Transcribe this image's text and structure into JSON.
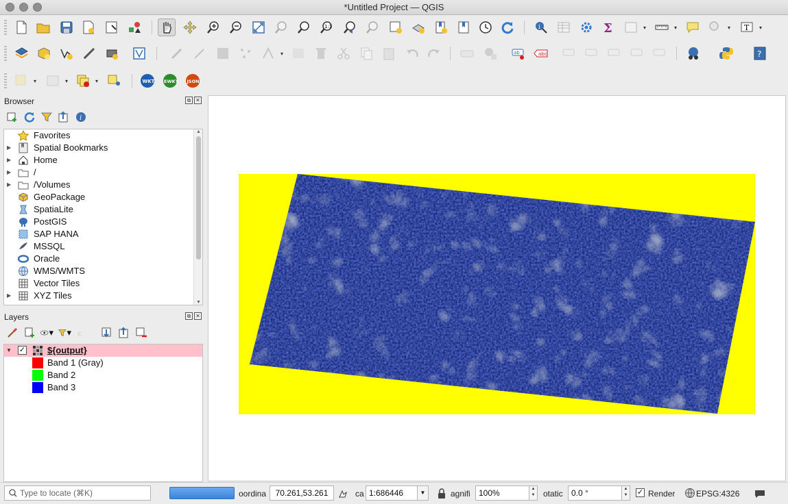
{
  "window": {
    "title": "*Untitled Project — QGIS"
  },
  "browser": {
    "title": "Browser",
    "items": [
      {
        "label": "Favorites",
        "icon": "star-icon",
        "expandable": false
      },
      {
        "label": "Spatial Bookmarks",
        "icon": "bookmark-icon",
        "expandable": true
      },
      {
        "label": "Home",
        "icon": "home-icon",
        "expandable": true
      },
      {
        "label": "/",
        "icon": "folder-icon",
        "expandable": true
      },
      {
        "label": "/Volumes",
        "icon": "folder-icon",
        "expandable": true
      },
      {
        "label": "GeoPackage",
        "icon": "geopackage-icon",
        "expandable": false
      },
      {
        "label": "SpatiaLite",
        "icon": "spatialite-icon",
        "expandable": false
      },
      {
        "label": "PostGIS",
        "icon": "postgis-icon",
        "expandable": false
      },
      {
        "label": "SAP HANA",
        "icon": "sap-hana-icon",
        "expandable": false
      },
      {
        "label": "MSSQL",
        "icon": "mssql-icon",
        "expandable": false
      },
      {
        "label": "Oracle",
        "icon": "oracle-icon",
        "expandable": false
      },
      {
        "label": "WMS/WMTS",
        "icon": "globe-icon",
        "expandable": false
      },
      {
        "label": "Vector Tiles",
        "icon": "grid-icon",
        "expandable": false
      },
      {
        "label": "XYZ Tiles",
        "icon": "grid-icon",
        "expandable": true
      }
    ]
  },
  "layers": {
    "title": "Layers",
    "layer_name": "${output}",
    "bands": [
      {
        "label": "Band 1 (Gray)",
        "color": "#ff0000"
      },
      {
        "label": "Band 2",
        "color": "#00ff00"
      },
      {
        "label": "Band 3",
        "color": "#0000ff"
      }
    ]
  },
  "toolbar": {
    "plugin_buttons": [
      "WKT",
      "EWKT",
      "JSON"
    ]
  },
  "statusbar": {
    "locator_placeholder": "Type to locate (⌘K)",
    "coordinate_label": "oordina",
    "coordinate_value": "70.261,53.261",
    "scale_label": "ca",
    "scale_value": "1:686446",
    "magnifier_label": "agnifi",
    "magnifier_value": "100%",
    "rotation_label": "otatic",
    "rotation_value": "0.0 °",
    "render_label": "Render",
    "crs": "EPSG:4326"
  },
  "colors": {
    "selected_layer_bg": "#ffc0cb",
    "map_background": "#ffffff",
    "raster_extent": "#ffff00"
  }
}
